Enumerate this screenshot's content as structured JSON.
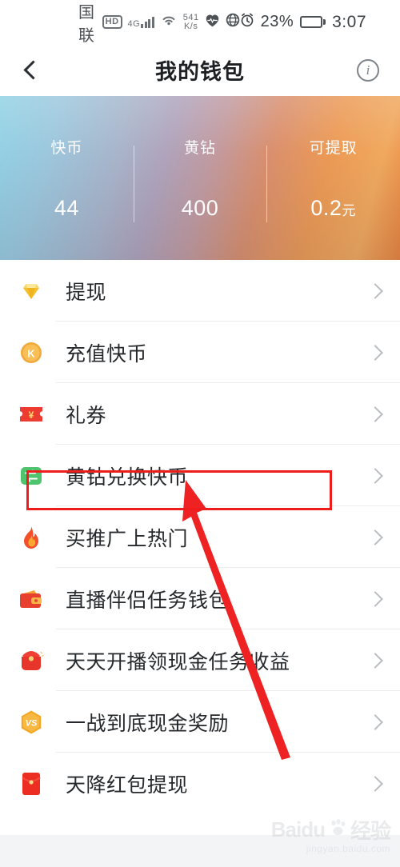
{
  "status_bar": {
    "carrier": "中国联通",
    "hd_badge": "HD",
    "network_type": "4G",
    "network_sub": "G",
    "speed_value": "541",
    "speed_unit": "K/s",
    "heart_icon": "heart-icon",
    "globe_icon": "globe-icon",
    "alarm_icon": "alarm-icon",
    "battery_percent": "23%",
    "time": "3:07"
  },
  "header": {
    "back_label": "返回",
    "title": "我的钱包",
    "info_label": "i"
  },
  "balance": {
    "columns": [
      {
        "label": "快币",
        "value": "44",
        "unit": ""
      },
      {
        "label": "黄钻",
        "value": "400",
        "unit": ""
      },
      {
        "label": "可提取",
        "value": "0.2",
        "unit": "元"
      }
    ],
    "gradient_start": "#91d2e5",
    "gradient_mid": "#b0a3bb",
    "gradient_end": "#e8833f"
  },
  "menu": {
    "items": [
      {
        "label": "提现",
        "icon": "diamond-icon"
      },
      {
        "label": "充值快币",
        "icon": "k-coin-icon"
      },
      {
        "label": "礼券",
        "icon": "coupon-ticket-icon"
      },
      {
        "label": "黄钻兑换快币",
        "icon": "exchange-icon"
      },
      {
        "label": "买推广上热门",
        "icon": "flame-icon"
      },
      {
        "label": "直播伴侣任务钱包",
        "icon": "wallet-icon"
      },
      {
        "label": "天天开播领现金任务收益",
        "icon": "gift-purse-icon"
      },
      {
        "label": "一战到底现金奖励",
        "icon": "vs-hexagon-icon"
      },
      {
        "label": "天降红包提现",
        "icon": "red-envelope-icon"
      }
    ],
    "chevron_icon": "chevron-right-icon"
  },
  "annotation": {
    "highlight_color": "#ef1c1c",
    "highlight_target": "黄钻兑换快币",
    "arrow_color": "#ee2222"
  },
  "watermark": {
    "brand": "Baidu",
    "brand_cn": "经验",
    "url": "jingyan.baidu.com"
  }
}
